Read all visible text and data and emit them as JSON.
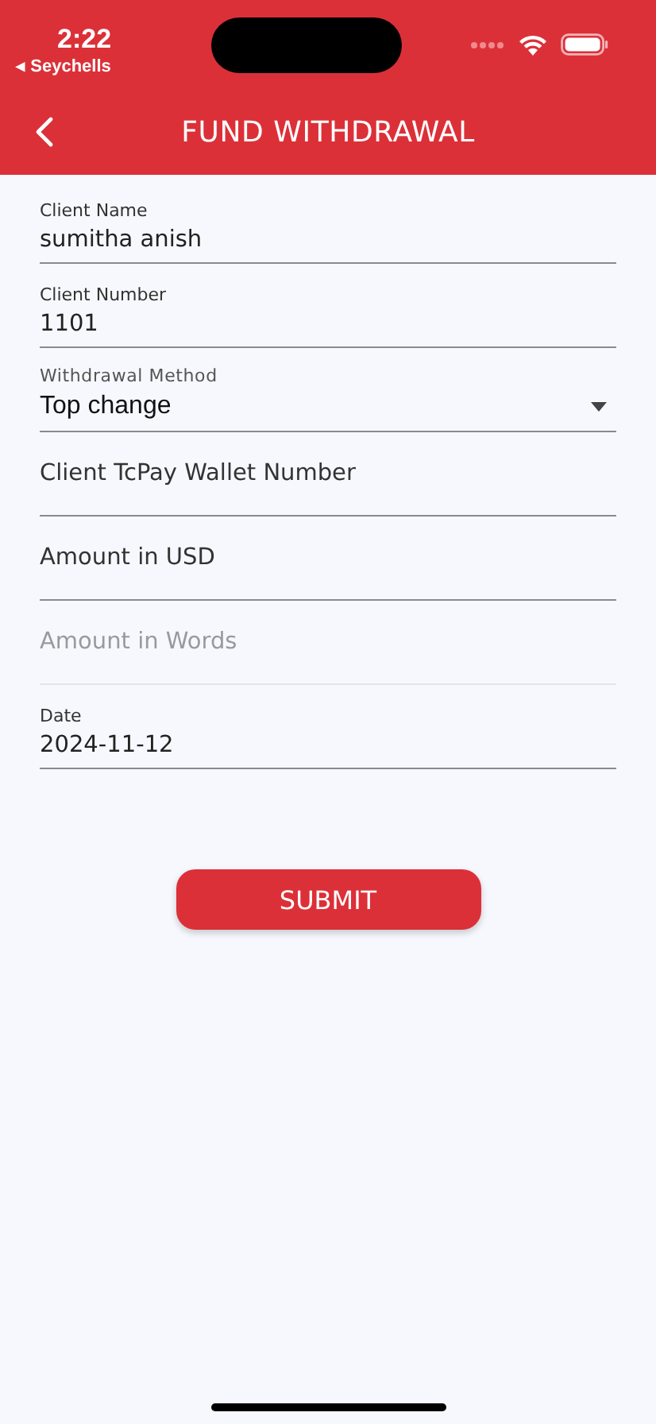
{
  "status_bar": {
    "time": "2:22",
    "back_label": "◂ Seychells"
  },
  "header": {
    "title": "FUND WITHDRAWAL"
  },
  "fields": [
    {
      "kind": "text",
      "label": "Client Name",
      "value": "sumitha anish"
    },
    {
      "kind": "text",
      "label": "Client Number",
      "value": "1101"
    },
    {
      "kind": "select",
      "label": "Withdrawal Method",
      "value": "Top change"
    },
    {
      "kind": "empty",
      "placeholder": "Client TcPay Wallet Number",
      "disabled": false
    },
    {
      "kind": "empty",
      "placeholder": "Amount in USD",
      "disabled": false
    },
    {
      "kind": "empty",
      "placeholder": "Amount in Words",
      "disabled": true
    },
    {
      "kind": "text",
      "label": "Date",
      "value": "2024-11-12"
    }
  ],
  "submit": {
    "label": "SUBMIT"
  }
}
